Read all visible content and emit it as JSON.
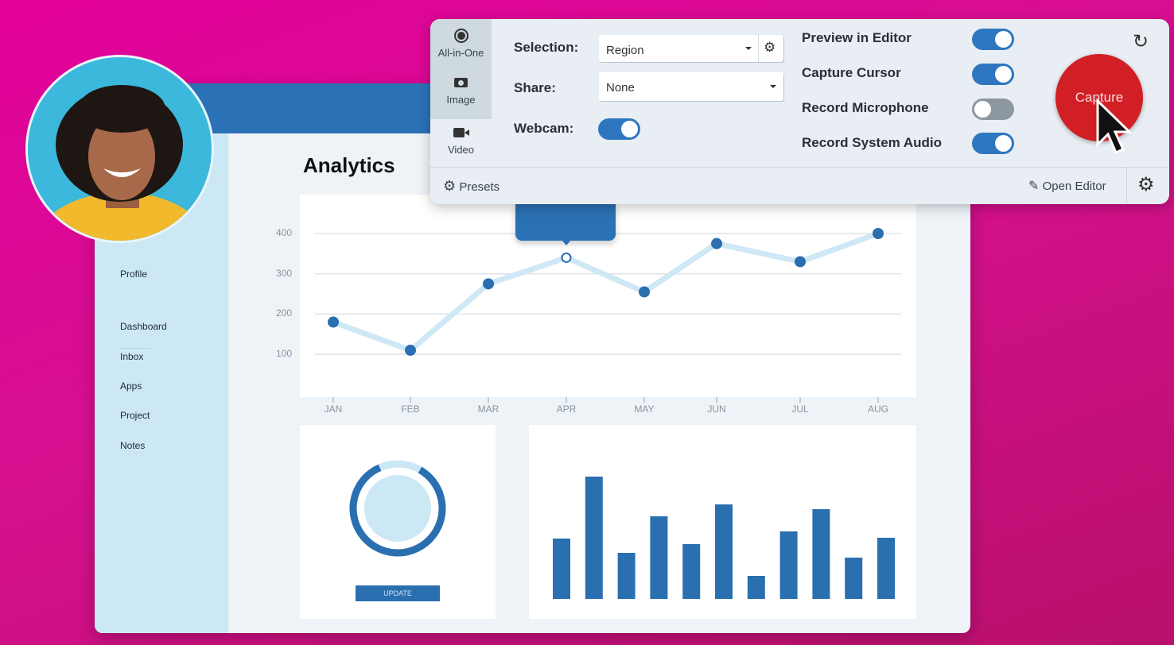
{
  "dashboard": {
    "title": "Analytics",
    "sidebar": [
      "Profile",
      "Dashboard",
      "Inbox",
      "Apps",
      "Project",
      "Notes"
    ],
    "update_button": "UPDATE",
    "donut_fraction": 0.85
  },
  "chart_data": [
    {
      "type": "line",
      "categories": [
        "JAN",
        "FEB",
        "MAR",
        "APR",
        "MAY",
        "JUN",
        "JUL",
        "AUG"
      ],
      "values": [
        180,
        110,
        275,
        340,
        255,
        375,
        330,
        400
      ],
      "yticks": [
        100,
        200,
        300,
        400
      ],
      "ylim": [
        0,
        420
      ],
      "grid": true,
      "highlighted": "APR"
    },
    {
      "type": "bar",
      "values": [
        76,
        154,
        58,
        104,
        69,
        119,
        29,
        85,
        113,
        52,
        77
      ]
    }
  ],
  "panel": {
    "tabs": [
      {
        "label": "All-in-One",
        "icon": "record-icon",
        "selected": true
      },
      {
        "label": "Image",
        "icon": "camera-icon",
        "selected": true
      },
      {
        "label": "Video",
        "icon": "video-camera-icon",
        "selected": false
      }
    ],
    "selection_label": "Selection:",
    "selection_value": "Region",
    "share_label": "Share:",
    "share_value": "None",
    "webcam_label": "Webcam:",
    "webcam_on": true,
    "toggles": [
      {
        "label": "Preview in Editor",
        "on": true
      },
      {
        "label": "Capture Cursor",
        "on": true
      },
      {
        "label": "Record Microphone",
        "on": false
      },
      {
        "label": "Record System Audio",
        "on": true
      }
    ],
    "capture_label": "Capture",
    "presets_label": "Presets",
    "open_editor_label": "Open Editor",
    "colors": {
      "accent": "#2f76c0",
      "capture": "#d21f26",
      "background": "#e2009b"
    }
  }
}
